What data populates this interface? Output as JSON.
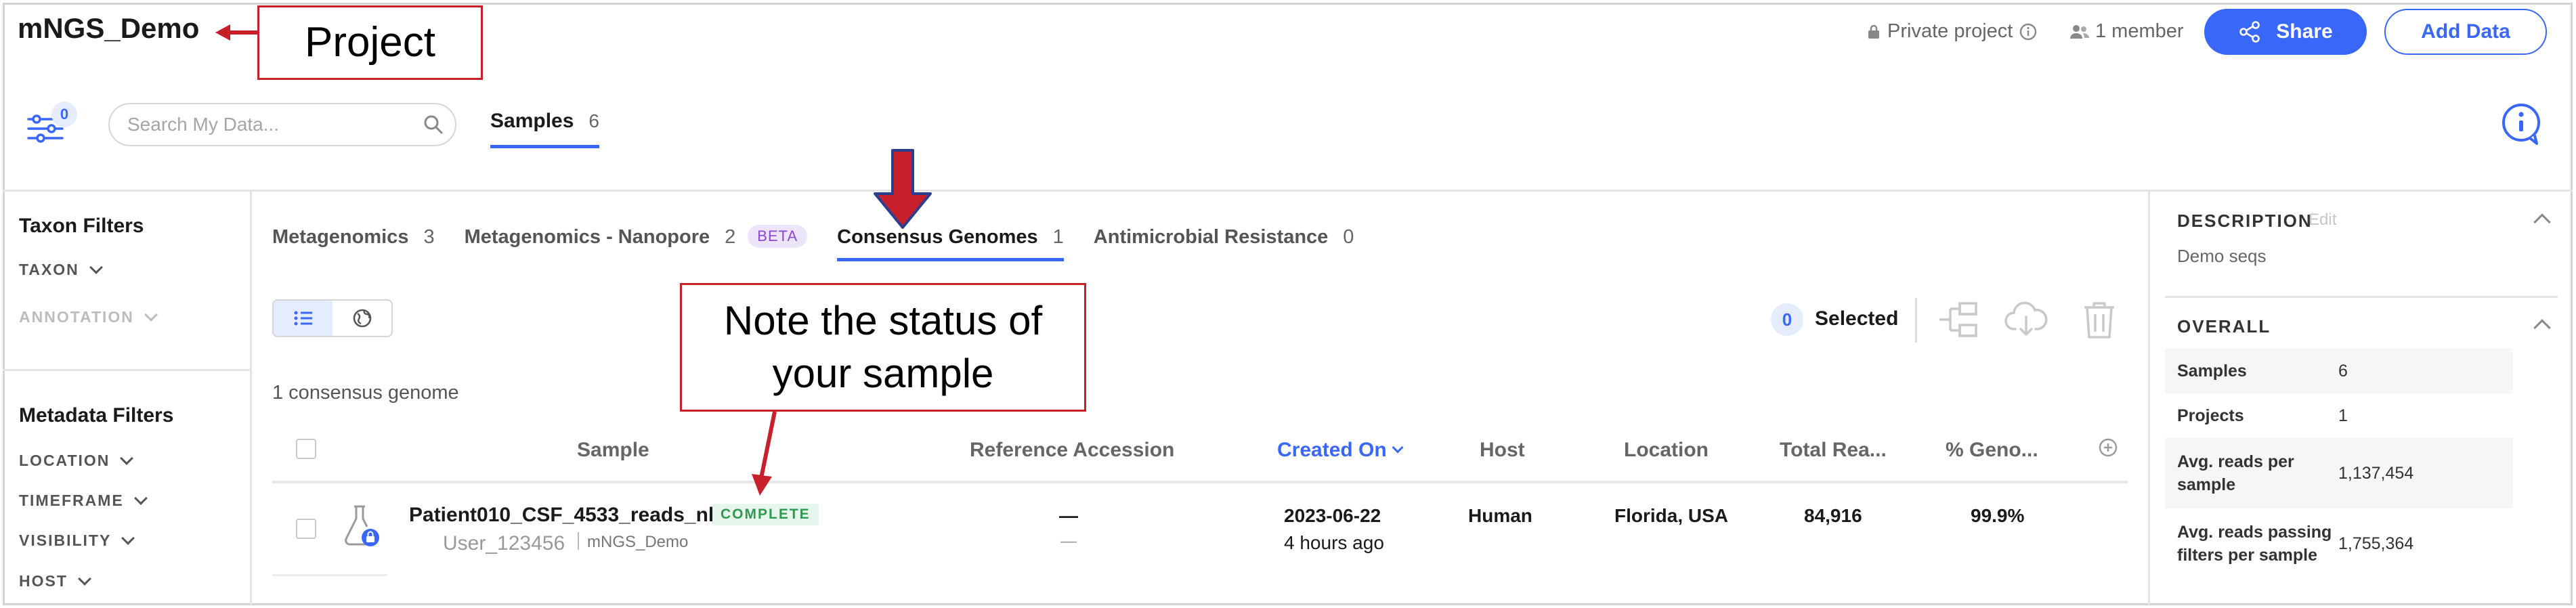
{
  "header": {
    "project_name": "mNGS_Demo",
    "privacy": "Private project",
    "members": "1 member",
    "share_label": "Share",
    "add_data_label": "Add Data"
  },
  "annotations": {
    "project_callout": "Project",
    "status_callout_line1": "Note the status of",
    "status_callout_line2": "your sample"
  },
  "toolbar": {
    "filter_count": "0",
    "search_placeholder": "Search My Data...",
    "samples_tab_label": "Samples",
    "samples_tab_count": "6"
  },
  "filters": {
    "taxon_heading": "Taxon Filters",
    "taxon": "TAXON",
    "annotation": "ANNOTATION",
    "metadata_heading": "Metadata Filters",
    "location": "LOCATION",
    "timeframe": "TIMEFRAME",
    "visibility": "VISIBILITY",
    "host": "HOST"
  },
  "tabs": [
    {
      "label": "Metagenomics",
      "count": "3"
    },
    {
      "label": "Metagenomics - Nanopore",
      "count": "2",
      "badge": "BETA"
    },
    {
      "label": "Consensus Genomes",
      "count": "1"
    },
    {
      "label": "Antimicrobial Resistance",
      "count": "0"
    }
  ],
  "selection": {
    "count": "0",
    "label": "Selected"
  },
  "count_line": "1 consensus genome",
  "table": {
    "headers": {
      "sample": "Sample",
      "reference": "Reference Accession",
      "created": "Created On",
      "host": "Host",
      "location": "Location",
      "total_reads": "Total Rea...",
      "genome": "% Geno..."
    },
    "row": {
      "name": "Patient010_CSF_4533_reads_nh",
      "status": "COMPLETE",
      "user": "User_123456",
      "project": "mNGS_Demo",
      "reference_main": "—",
      "reference_sub": "—",
      "created_date": "2023-06-22",
      "created_ago": "4 hours ago",
      "host": "Human",
      "location": "Florida, USA",
      "total_reads": "84,916",
      "genome": "99.9%"
    }
  },
  "details": {
    "description_heading": "DESCRIPTION",
    "edit_label": "Edit",
    "description": "Demo seqs",
    "overall_heading": "OVERALL",
    "overall": [
      {
        "k": "Samples",
        "v": "6"
      },
      {
        "k": "Projects",
        "v": "1"
      },
      {
        "k": "Avg. reads per sample",
        "v": "1,137,454"
      },
      {
        "k": "Avg. reads passing filters per sample",
        "v": "1,755,364"
      }
    ]
  },
  "colors": {
    "accent": "#3867fa",
    "callout_red": "#c8202a",
    "status_green": "#2c9a4f",
    "beta_purple": "#8a47d6"
  }
}
